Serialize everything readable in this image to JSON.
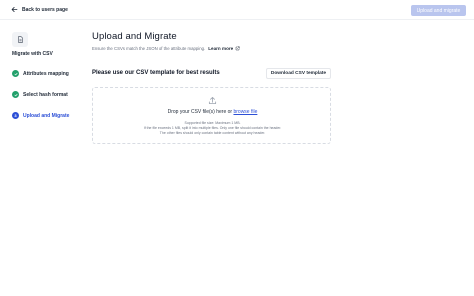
{
  "header": {
    "back_label": "Back to users page",
    "primary_button_label": "Upload and migrate"
  },
  "sidebar": {
    "title": "Migrate with CSV",
    "steps": [
      {
        "label": "Attributes mapping",
        "state": "done"
      },
      {
        "label": "Select hash format",
        "state": "done"
      },
      {
        "label": "Upload and Migrate",
        "state": "active",
        "number": "3"
      }
    ]
  },
  "main": {
    "title": "Upload and Migrate",
    "subtitle": "Ensure the CSVs match the JSON of the attribute mapping.",
    "learn_more": "Learn more",
    "template_prompt": "Please use our CSV template for best results",
    "download_label": "Download CSV template",
    "dropzone": {
      "prompt": "Drop your CSV file(s) here or",
      "browse_label": "browse file",
      "info_line1": "Supported file size: Maximum 1 MB.",
      "info_line2": "If the file exceeds 1 MB, split it into multiple files. Only one file should contain the header.",
      "info_line3": "The other files should only contain table content without any header."
    }
  },
  "colors": {
    "accent": "#2c4fd6",
    "success": "#22a06b",
    "disabled_button": "#b9c5ee"
  },
  "icons": {
    "back": "arrow-left-icon",
    "migrate": "file-csv-icon",
    "done": "check-icon",
    "external": "external-link-icon",
    "upload": "upload-icon"
  }
}
